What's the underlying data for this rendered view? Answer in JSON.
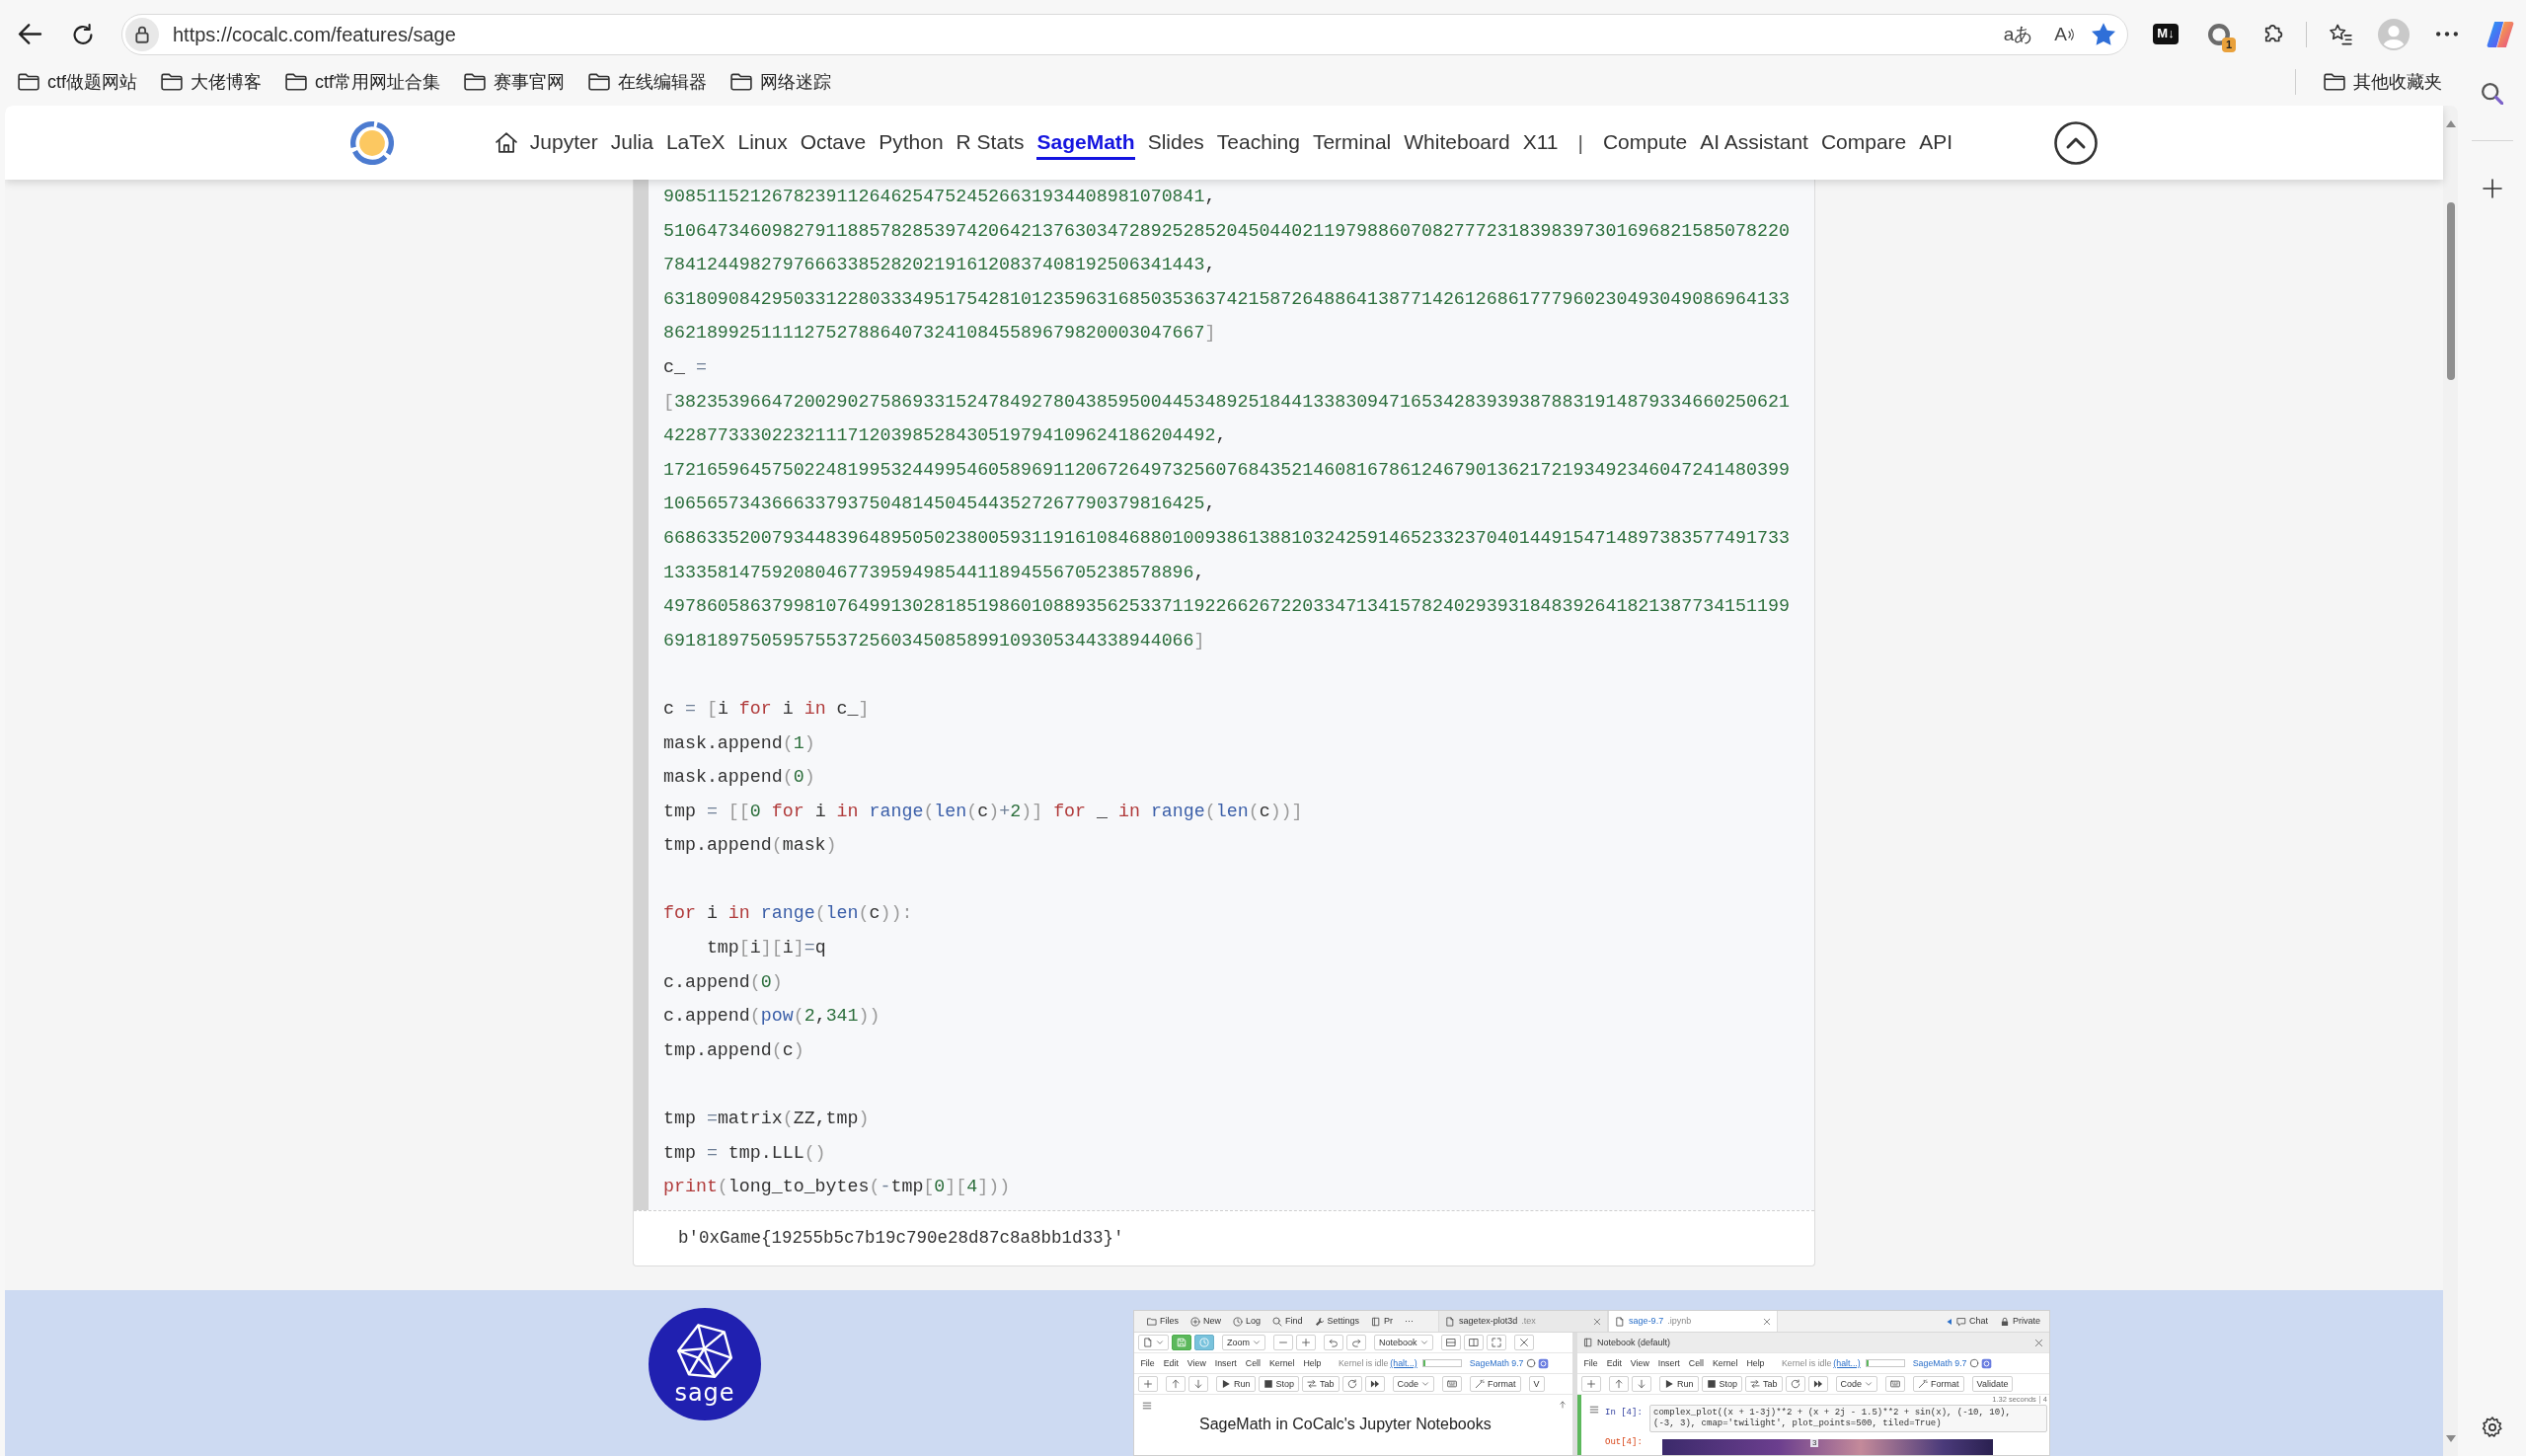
{
  "browser": {
    "address_bar": {
      "url": "https://cocalc.com/features/sage",
      "actions": [
        {
          "kind": "translate",
          "label": "aあ"
        },
        {
          "kind": "read_aloud",
          "label": "A"
        },
        {
          "kind": "favorite",
          "on": true
        }
      ]
    },
    "toolbar": [
      {
        "kind": "markdown",
        "label": "M↓"
      },
      {
        "kind": "notifications",
        "badge": "1"
      },
      {
        "kind": "extensions"
      },
      {
        "kind": "divider"
      },
      {
        "kind": "favorites"
      },
      {
        "kind": "profile"
      },
      {
        "kind": "more"
      },
      {
        "kind": "copilot"
      }
    ],
    "bookmarks": [
      {
        "label": "ctf做题网站"
      },
      {
        "label": "大佬博客"
      },
      {
        "label": "ctf常用网址合集"
      },
      {
        "label": "赛事官网"
      },
      {
        "label": "在线编辑器"
      },
      {
        "label": "网络迷踪"
      }
    ],
    "other_bookmarks": {
      "label": "其他收藏夹"
    }
  },
  "site_nav": {
    "home": {
      "selected": false
    },
    "links": [
      {
        "label": "Jupyter",
        "selected": false
      },
      {
        "label": "Julia",
        "selected": false
      },
      {
        "label": "LaTeX",
        "selected": false
      },
      {
        "label": "Linux",
        "selected": false
      },
      {
        "label": "Octave",
        "selected": false
      },
      {
        "label": "Python",
        "selected": false
      },
      {
        "label": "R Stats",
        "selected": false
      },
      {
        "label": "SageMath",
        "selected": true
      },
      {
        "label": "Slides",
        "selected": false
      },
      {
        "label": "Teaching",
        "selected": false
      },
      {
        "label": "Terminal",
        "selected": false
      },
      {
        "label": "Whiteboard",
        "selected": false
      },
      {
        "label": "X11",
        "selected": false
      }
    ],
    "separator": "|",
    "more_links": [
      {
        "label": "Compute",
        "selected": false
      },
      {
        "label": "AI Assistant",
        "selected": false
      },
      {
        "label": "Compare",
        "selected": false
      },
      {
        "label": "API",
        "selected": false
      }
    ]
  },
  "notebook_cell": {
    "code_blocks": [
      {
        "lines": [
          {
            "tokens": [
              {
                "kind": "number",
                "text": "90851152126782391126462547524526631934408981070841"
              },
              {
                "kind": "plain",
                "text": ","
              }
            ]
          },
          {
            "tokens": [
              {
                "kind": "number",
                "text": "51064734609827911885782853974206421376303472892528520450440211979886070827772318398397301696821585078220"
              }
            ]
          },
          {
            "tokens": [
              {
                "kind": "number",
                "text": "78412449827976663385282021916120837408192506341443"
              },
              {
                "kind": "plain",
                "text": ","
              }
            ]
          },
          {
            "tokens": [
              {
                "kind": "number",
                "text": "63180908429503312280333495175428101235963168503536374215872648864138771426126861777960230493049086964133"
              }
            ]
          },
          {
            "tokens": [
              {
                "kind": "number",
                "text": "86218992511112752788640732410845589679820003047667"
              },
              {
                "kind": "bracket",
                "text": "]"
              }
            ]
          },
          {
            "tokens": [
              {
                "kind": "plain",
                "text": "c_ "
              },
              {
                "kind": "operator",
                "text": "="
              }
            ]
          },
          {
            "tokens": [
              {
                "kind": "bracket",
                "text": "["
              },
              {
                "kind": "number",
                "text": "3823539664720029027586933152478492780438595004453489251844133830947165342839393878831914879334660250621"
              }
            ]
          },
          {
            "tokens": [
              {
                "kind": "number",
                "text": "422877333022321117120398528430519794109624186204492"
              },
              {
                "kind": "plain",
                "text": ","
              }
            ]
          },
          {
            "tokens": [
              {
                "kind": "number",
                "text": "17216596457502248199532449954605896911206726497325607684352146081678612467901362172193492346047241480399"
              }
            ]
          },
          {
            "tokens": [
              {
                "kind": "number",
                "text": "10656573436663379375048145045443527267790379816425"
              },
              {
                "kind": "plain",
                "text": ","
              }
            ]
          },
          {
            "tokens": [
              {
                "kind": "number",
                "text": "66863352007934483964895050238005931191610846880100938613881032425914652332370401449154714897383577491733"
              }
            ]
          },
          {
            "tokens": [
              {
                "kind": "number",
                "text": "1333581475920804677395949854411894556705238578896"
              },
              {
                "kind": "plain",
                "text": ","
              }
            ]
          },
          {
            "tokens": [
              {
                "kind": "number",
                "text": "49786058637998107649913028185198601088935625337119226626722033471341578240293931848392641821387734151199"
              }
            ]
          },
          {
            "tokens": [
              {
                "kind": "number",
                "text": "6918189750595755372560345085899109305344338944066"
              },
              {
                "kind": "bracket",
                "text": "]"
              }
            ]
          }
        ]
      },
      {
        "lines": [
          {
            "tokens": [
              {
                "kind": "plain",
                "text": "c "
              },
              {
                "kind": "operator",
                "text": "= "
              },
              {
                "kind": "bracket",
                "text": "["
              },
              {
                "kind": "plain",
                "text": "i "
              },
              {
                "kind": "keyword",
                "text": "for"
              },
              {
                "kind": "plain",
                "text": " i "
              },
              {
                "kind": "keyword",
                "text": "in"
              },
              {
                "kind": "plain",
                "text": " c_"
              },
              {
                "kind": "bracket",
                "text": "]"
              }
            ]
          },
          {
            "tokens": [
              {
                "kind": "plain",
                "text": "mask.append"
              },
              {
                "kind": "bracket",
                "text": "("
              },
              {
                "kind": "number",
                "text": "1"
              },
              {
                "kind": "bracket",
                "text": ")"
              }
            ]
          },
          {
            "tokens": [
              {
                "kind": "plain",
                "text": "mask.append"
              },
              {
                "kind": "bracket",
                "text": "("
              },
              {
                "kind": "number",
                "text": "0"
              },
              {
                "kind": "bracket",
                "text": ")"
              }
            ]
          },
          {
            "tokens": [
              {
                "kind": "plain",
                "text": "tmp "
              },
              {
                "kind": "operator",
                "text": "= "
              },
              {
                "kind": "bracket",
                "text": "[["
              },
              {
                "kind": "number",
                "text": "0 "
              },
              {
                "kind": "keyword",
                "text": "for"
              },
              {
                "kind": "plain",
                "text": " i "
              },
              {
                "kind": "keyword",
                "text": "in "
              },
              {
                "kind": "builtin",
                "text": "range"
              },
              {
                "kind": "bracket",
                "text": "("
              },
              {
                "kind": "builtin",
                "text": "len"
              },
              {
                "kind": "bracket",
                "text": "("
              },
              {
                "kind": "plain",
                "text": "c"
              },
              {
                "kind": "bracket",
                "text": ")"
              },
              {
                "kind": "operator",
                "text": "+"
              },
              {
                "kind": "number",
                "text": "2"
              },
              {
                "kind": "bracket",
                "text": ")] "
              },
              {
                "kind": "keyword",
                "text": "for"
              },
              {
                "kind": "plain",
                "text": " _ "
              },
              {
                "kind": "keyword",
                "text": "in "
              },
              {
                "kind": "builtin",
                "text": "range"
              },
              {
                "kind": "bracket",
                "text": "("
              },
              {
                "kind": "builtin",
                "text": "len"
              },
              {
                "kind": "bracket",
                "text": "("
              },
              {
                "kind": "plain",
                "text": "c"
              },
              {
                "kind": "bracket",
                "text": "))]"
              }
            ]
          },
          {
            "tokens": [
              {
                "kind": "plain",
                "text": "tmp.append"
              },
              {
                "kind": "bracket",
                "text": "("
              },
              {
                "kind": "plain",
                "text": "mask"
              },
              {
                "kind": "bracket",
                "text": ")"
              }
            ]
          }
        ]
      },
      {
        "lines": [
          {
            "tokens": [
              {
                "kind": "keyword",
                "text": "for"
              },
              {
                "kind": "plain",
                "text": " i "
              },
              {
                "kind": "keyword",
                "text": "in "
              },
              {
                "kind": "builtin",
                "text": "range"
              },
              {
                "kind": "bracket",
                "text": "("
              },
              {
                "kind": "builtin",
                "text": "len"
              },
              {
                "kind": "bracket",
                "text": "("
              },
              {
                "kind": "plain",
                "text": "c"
              },
              {
                "kind": "bracket",
                "text": ")):"
              }
            ]
          },
          {
            "tokens": [
              {
                "kind": "plain",
                "text": "    tmp"
              },
              {
                "kind": "bracket",
                "text": "["
              },
              {
                "kind": "plain",
                "text": "i"
              },
              {
                "kind": "bracket",
                "text": "]["
              },
              {
                "kind": "plain",
                "text": "i"
              },
              {
                "kind": "bracket",
                "text": "]"
              },
              {
                "kind": "operator",
                "text": "="
              },
              {
                "kind": "plain",
                "text": "q"
              }
            ]
          },
          {
            "tokens": [
              {
                "kind": "plain",
                "text": "c.append"
              },
              {
                "kind": "bracket",
                "text": "("
              },
              {
                "kind": "number",
                "text": "0"
              },
              {
                "kind": "bracket",
                "text": ")"
              }
            ]
          },
          {
            "tokens": [
              {
                "kind": "plain",
                "text": "c.append"
              },
              {
                "kind": "bracket",
                "text": "("
              },
              {
                "kind": "builtin",
                "text": "pow"
              },
              {
                "kind": "bracket",
                "text": "("
              },
              {
                "kind": "number",
                "text": "2"
              },
              {
                "kind": "plain",
                "text": ","
              },
              {
                "kind": "number",
                "text": "341"
              },
              {
                "kind": "bracket",
                "text": "))"
              }
            ]
          },
          {
            "tokens": [
              {
                "kind": "plain",
                "text": "tmp.append"
              },
              {
                "kind": "bracket",
                "text": "("
              },
              {
                "kind": "plain",
                "text": "c"
              },
              {
                "kind": "bracket",
                "text": ")"
              }
            ]
          }
        ]
      },
      {
        "lines": [
          {
            "tokens": [
              {
                "kind": "plain",
                "text": "tmp "
              },
              {
                "kind": "operator",
                "text": "="
              },
              {
                "kind": "plain",
                "text": "matrix"
              },
              {
                "kind": "bracket",
                "text": "("
              },
              {
                "kind": "plain",
                "text": "ZZ,tmp"
              },
              {
                "kind": "bracket",
                "text": ")"
              }
            ]
          },
          {
            "tokens": [
              {
                "kind": "plain",
                "text": "tmp "
              },
              {
                "kind": "operator",
                "text": "="
              },
              {
                "kind": "plain",
                "text": " tmp.LLL"
              },
              {
                "kind": "bracket",
                "text": "()"
              }
            ]
          },
          {
            "tokens": [
              {
                "kind": "keyword",
                "text": "print"
              },
              {
                "kind": "bracket",
                "text": "("
              },
              {
                "kind": "plain",
                "text": "long_to_bytes"
              },
              {
                "kind": "bracket",
                "text": "("
              },
              {
                "kind": "operator",
                "text": "-"
              },
              {
                "kind": "plain",
                "text": "tmp"
              },
              {
                "kind": "bracket",
                "text": "["
              },
              {
                "kind": "number",
                "text": "0"
              },
              {
                "kind": "bracket",
                "text": "]["
              },
              {
                "kind": "number",
                "text": "4"
              },
              {
                "kind": "bracket",
                "text": "]))"
              }
            ]
          }
        ]
      }
    ],
    "output": "b'0xGame{19255b5c7b19c790e28d87c8a8bb1d33}'"
  },
  "sage_banner": {
    "logo_text": "sage",
    "screenshot": {
      "toolbar": [
        {
          "kind": "files",
          "label": "Files"
        },
        {
          "kind": "new",
          "label": "New"
        },
        {
          "kind": "log",
          "label": "Log"
        },
        {
          "kind": "find",
          "label": "Find"
        },
        {
          "kind": "settings",
          "label": "Settings"
        },
        {
          "kind": "project",
          "label": "Pr"
        }
      ],
      "overflow": "···",
      "tabs": [
        {
          "name": "sagetex-plot3d",
          "ext": ".tex",
          "selected": false
        },
        {
          "name": "sage-9.7",
          "ext": ".ipynb",
          "selected": true
        }
      ],
      "chat": "Chat",
      "visibility": "Private",
      "left_pane": {
        "frame_controls": [
          {
            "kind": "file_menu"
          },
          {
            "kind": "save"
          },
          {
            "kind": "time_travel"
          },
          {
            "kind": "zoom",
            "label": "Zoom"
          },
          {
            "kind": "zoom_out"
          },
          {
            "kind": "zoom_in"
          },
          {
            "kind": "undo"
          },
          {
            "kind": "redo"
          },
          {
            "kind": "view",
            "label": "Notebook"
          },
          {
            "kind": "split_h"
          },
          {
            "kind": "split_v"
          },
          {
            "kind": "fullscreen"
          },
          {
            "kind": "close"
          }
        ],
        "menu": [
          "File",
          "Edit",
          "View",
          "Insert",
          "Cell",
          "Kernel",
          "Help"
        ],
        "kernel_status": "Kernel is idle",
        "halt_link": "(halt...)",
        "kernel_meter": {
          "level": 0.06
        },
        "kernel_name": "SageMath 9.7",
        "tools": [
          {
            "kind": "insert"
          },
          {
            "kind": "move_up"
          },
          {
            "kind": "move_down"
          },
          {
            "kind": "run",
            "label": "Run"
          },
          {
            "kind": "stop",
            "label": "Stop"
          },
          {
            "kind": "tab",
            "label": "Tab"
          },
          {
            "kind": "restart"
          },
          {
            "kind": "run_all"
          },
          {
            "kind": "cell_type",
            "label": "Code"
          },
          {
            "kind": "keyboard"
          },
          {
            "kind": "format",
            "label": "Format"
          },
          {
            "kind": "validate",
            "label": "V"
          }
        ],
        "heading": "SageMath in CoCalc's Jupyter Notebooks"
      },
      "right_pane": {
        "title": "Notebook (default)",
        "menu": [
          "File",
          "Edit",
          "View",
          "Insert",
          "Cell",
          "Kernel",
          "Help"
        ],
        "kernel_status": "Kernel is idle",
        "halt_link": "(halt...)",
        "kernel_meter": {
          "level": 0.06
        },
        "kernel_name": "SageMath 9.7",
        "tools": [
          {
            "kind": "insert"
          },
          {
            "kind": "move_up"
          },
          {
            "kind": "move_down"
          },
          {
            "kind": "run",
            "label": "Run"
          },
          {
            "kind": "stop",
            "label": "Stop"
          },
          {
            "kind": "tab",
            "label": "Tab"
          },
          {
            "kind": "restart"
          },
          {
            "kind": "run_all"
          },
          {
            "kind": "cell_type",
            "label": "Code"
          },
          {
            "kind": "keyboard"
          },
          {
            "kind": "format",
            "label": "Format"
          },
          {
            "kind": "validate",
            "label": "Validate"
          }
        ],
        "cell": {
          "prompt": "In [4]:",
          "timing": "1.32 seconds",
          "badge": "4",
          "code": [
            "complex_plot((x + 1-3j)**2 + (x + 2j - 1.5)**2 + sin(x), (-10, 10),",
            "(-3, 3), cmap='twilight', plot_points=500, tiled=True)"
          ],
          "output_prompt": "Out[4]:",
          "plot_tick": "3"
        }
      }
    }
  }
}
